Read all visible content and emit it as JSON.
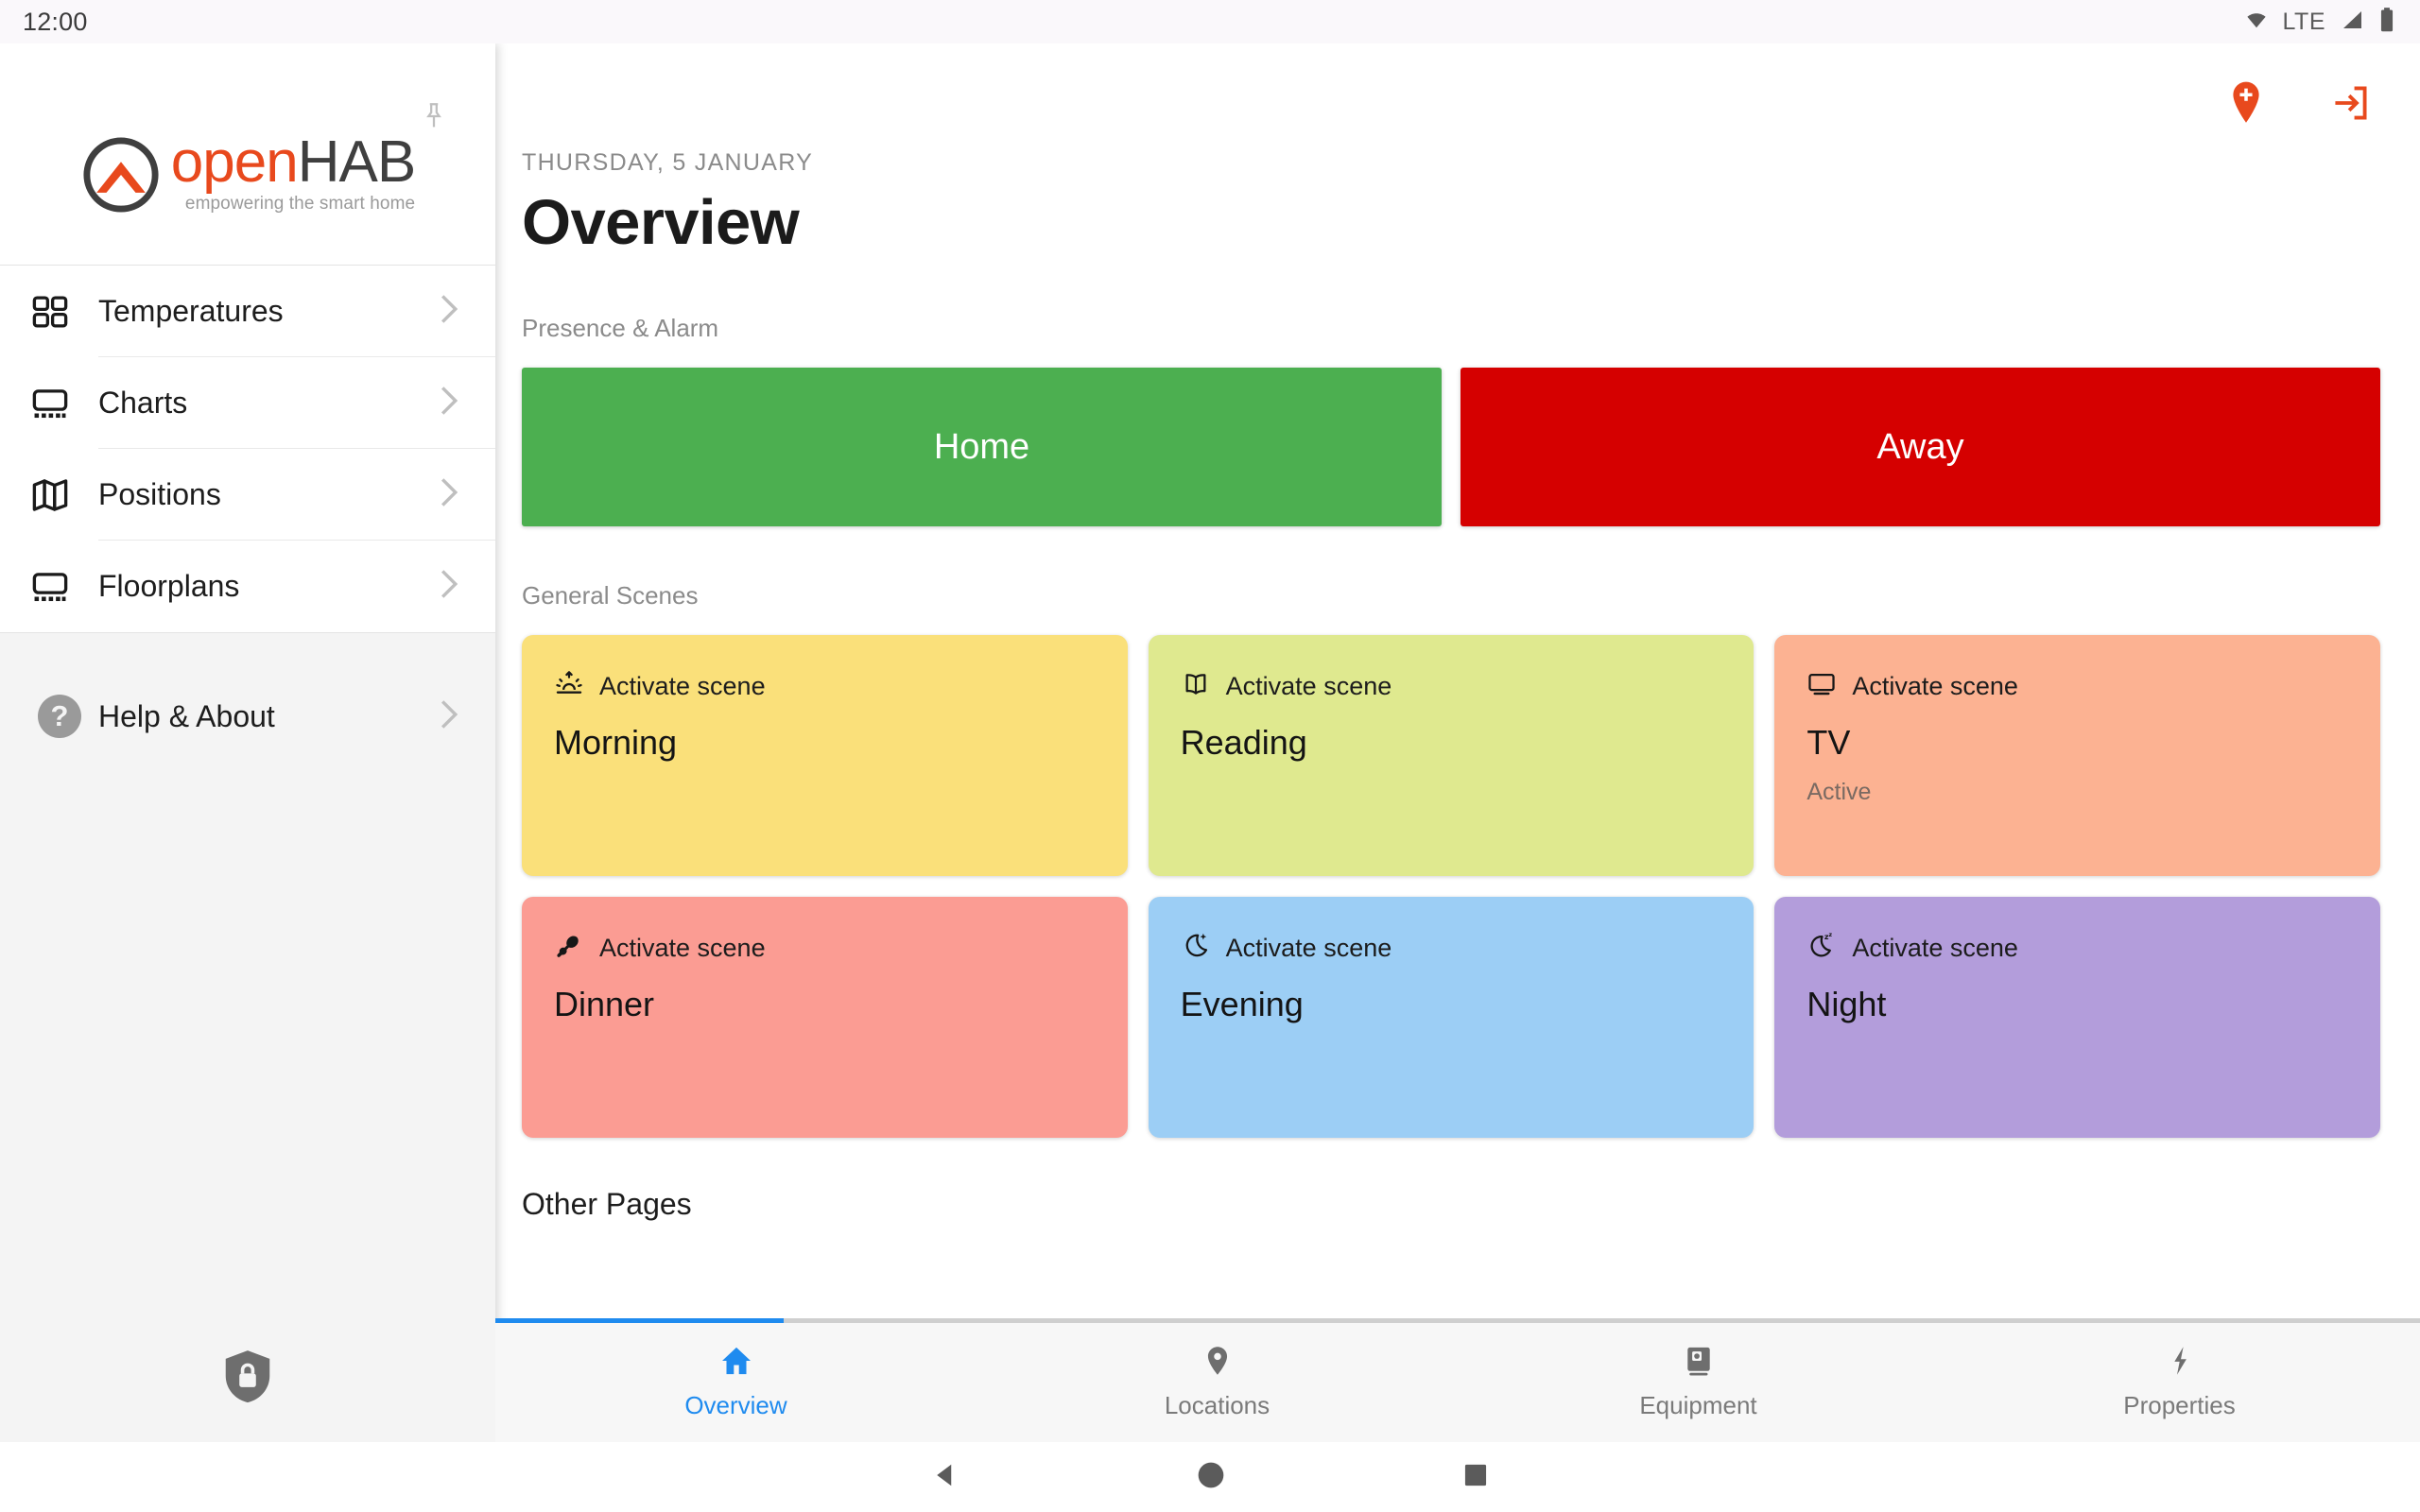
{
  "status_bar": {
    "clock": "12:00",
    "network_label": "LTE",
    "icons": [
      "wifi-icon",
      "signal-icon",
      "battery-icon"
    ]
  },
  "sidebar": {
    "pin_icon": "pin-icon",
    "logo": {
      "open": "open",
      "hab": "HAB",
      "tagline": "empowering the smart home"
    },
    "items": [
      {
        "label": "Temperatures",
        "icon": "grid-icon"
      },
      {
        "label": "Charts",
        "icon": "chart-icon"
      },
      {
        "label": "Positions",
        "icon": "map-icon"
      },
      {
        "label": "Floorplans",
        "icon": "floorplan-icon"
      }
    ],
    "help": {
      "label": "Help & About",
      "icon": "question-circle-icon"
    },
    "footer": {
      "icon": "lock-icon"
    }
  },
  "topbar": {
    "add_location_icon": "map-pin-plus-icon",
    "login_icon": "login-icon",
    "accent": "#e8491d"
  },
  "header": {
    "date": "THURSDAY, 5 JANUARY",
    "title": "Overview"
  },
  "presence": {
    "section_label": "Presence & Alarm",
    "buttons": [
      {
        "label": "Home",
        "color": "#4caf50"
      },
      {
        "label": "Away",
        "color": "#d50000"
      }
    ]
  },
  "scenes": {
    "section_label": "General Scenes",
    "action_label": "Activate scene",
    "cards": [
      {
        "name": "Morning",
        "icon": "sunrise-icon",
        "color": "#fae07a",
        "status": ""
      },
      {
        "name": "Reading",
        "icon": "book-icon",
        "color": "#dfe98f",
        "status": ""
      },
      {
        "name": "TV",
        "icon": "tv-icon",
        "color": "#fcb292",
        "status": "Active"
      },
      {
        "name": "Dinner",
        "icon": "drumstick-icon",
        "color": "#fb9c93",
        "status": ""
      },
      {
        "name": "Evening",
        "icon": "moon-stars-icon",
        "color": "#9ccef5",
        "status": ""
      },
      {
        "name": "Night",
        "icon": "moon-zzz-icon",
        "color": "#b39ddb",
        "status": ""
      }
    ]
  },
  "other_pages": {
    "label": "Other Pages"
  },
  "tabbar": {
    "progress_percent": 15,
    "active_color": "#1f8bef",
    "tabs": [
      {
        "label": "Overview",
        "icon": "home-icon",
        "active": true
      },
      {
        "label": "Locations",
        "icon": "location-pin-icon",
        "active": false
      },
      {
        "label": "Equipment",
        "icon": "equipment-icon",
        "active": false
      },
      {
        "label": "Properties",
        "icon": "bolt-icon",
        "active": false
      }
    ]
  },
  "android_nav": {
    "back_icon": "triangle-back-icon",
    "home_icon": "circle-home-icon",
    "recents_icon": "square-recents-icon"
  }
}
